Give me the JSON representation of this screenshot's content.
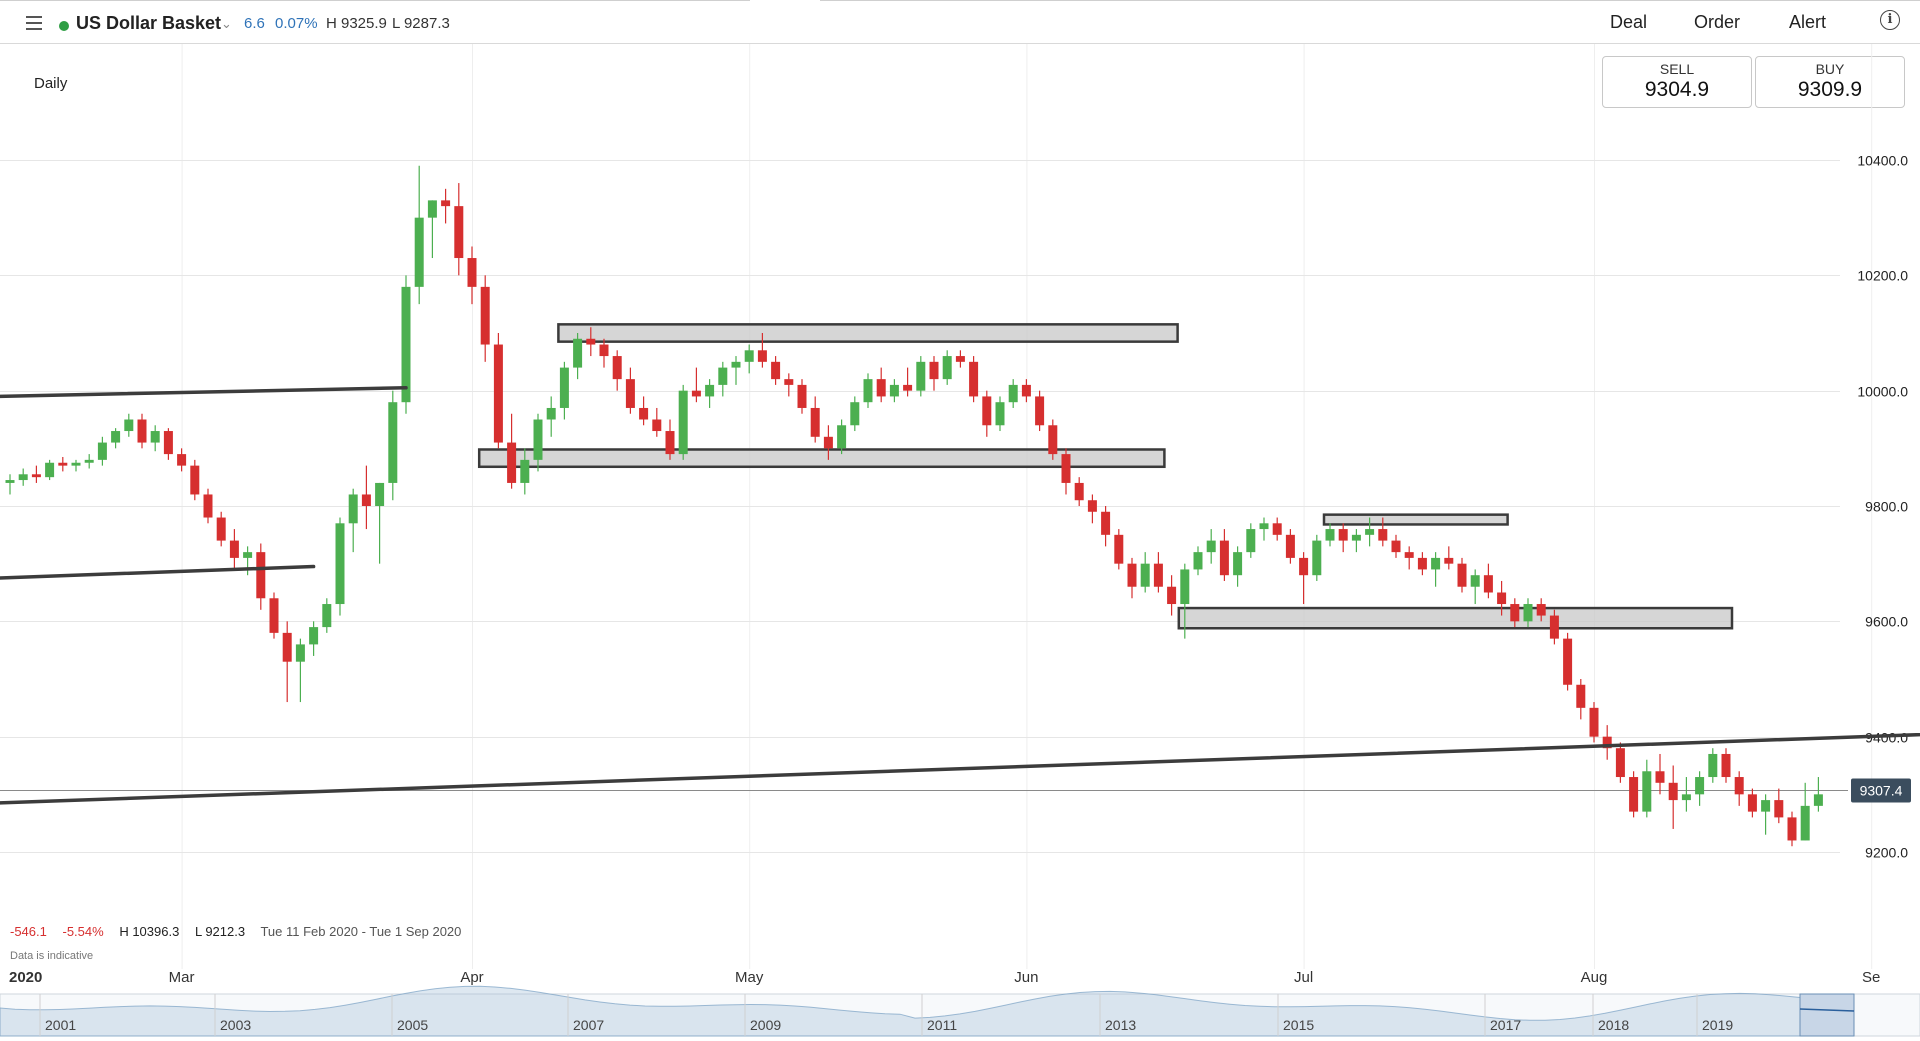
{
  "header": {
    "instrument": "US Dollar Basket",
    "change_points": "6.6",
    "change_pct": "0.07%",
    "high": "H 9325.9",
    "low": "L 9287.3",
    "actions": {
      "deal": "Deal",
      "order": "Order",
      "alert": "Alert"
    },
    "icons": {
      "menu": "hamburger-menu-icon",
      "chevron": "chevron-down-icon",
      "info": "info-icon",
      "status": "market-open-dot"
    }
  },
  "timeframe": "Daily",
  "quote": {
    "sell_label": "SELL",
    "sell_value": "9304.9",
    "buy_label": "BUY",
    "buy_value": "9309.9"
  },
  "stats": {
    "change": "-546.1",
    "change_pct": "-5.54%",
    "high": "H 10396.3",
    "low": "L 9212.3",
    "range": "Tue 11 Feb 2020 - Tue 1 Sep 2020",
    "note": "Data is indicative"
  },
  "colors": {
    "up": "#4caf50",
    "down": "#d62f2f",
    "accent": "#2f73b8",
    "status": "#2e9e44",
    "current_tag": "#3b4d5e"
  },
  "chart_data": {
    "type": "candlestick",
    "timeframe": "Daily",
    "ylim": [
      9000,
      10600
    ],
    "yticks": [
      10400,
      10200,
      10000,
      9800,
      9600,
      9400,
      9200
    ],
    "ytick_labels": [
      "10400.0",
      "10200.0",
      "10000.0",
      "9800.0",
      "9600.0",
      "9400.0",
      "9200.0"
    ],
    "x_labels": [
      {
        "label": "2020",
        "session": 0
      },
      {
        "label": "Mar",
        "session": 13
      },
      {
        "label": "Apr",
        "session": 35
      },
      {
        "label": "May",
        "session": 56
      },
      {
        "label": "Jun",
        "session": 77
      },
      {
        "label": "Jul",
        "session": 98
      },
      {
        "label": "Aug",
        "session": 120
      },
      {
        "label": "Se",
        "session": 141
      }
    ],
    "current_price": 9307.4,
    "current_price_label": "9307.4",
    "ohlc": [
      [
        9840,
        9855,
        9820,
        9845
      ],
      [
        9845,
        9865,
        9835,
        9855
      ],
      [
        9855,
        9870,
        9840,
        9850
      ],
      [
        9850,
        9880,
        9845,
        9875
      ],
      [
        9875,
        9885,
        9860,
        9870
      ],
      [
        9870,
        9880,
        9860,
        9875
      ],
      [
        9875,
        9890,
        9865,
        9880
      ],
      [
        9880,
        9920,
        9870,
        9910
      ],
      [
        9910,
        9935,
        9900,
        9930
      ],
      [
        9930,
        9960,
        9920,
        9950
      ],
      [
        9950,
        9960,
        9900,
        9910
      ],
      [
        9910,
        9940,
        9895,
        9930
      ],
      [
        9930,
        9935,
        9880,
        9890
      ],
      [
        9890,
        9900,
        9860,
        9870
      ],
      [
        9870,
        9880,
        9810,
        9820
      ],
      [
        9820,
        9830,
        9770,
        9780
      ],
      [
        9780,
        9790,
        9730,
        9740
      ],
      [
        9740,
        9760,
        9690,
        9710
      ],
      [
        9710,
        9730,
        9680,
        9720
      ],
      [
        9720,
        9735,
        9620,
        9640
      ],
      [
        9640,
        9650,
        9570,
        9580
      ],
      [
        9580,
        9600,
        9460,
        9530
      ],
      [
        9530,
        9570,
        9460,
        9560
      ],
      [
        9560,
        9600,
        9540,
        9590
      ],
      [
        9590,
        9640,
        9580,
        9630
      ],
      [
        9630,
        9780,
        9610,
        9770
      ],
      [
        9770,
        9830,
        9720,
        9820
      ],
      [
        9820,
        9870,
        9760,
        9800
      ],
      [
        9800,
        9840,
        9700,
        9840
      ],
      [
        9840,
        10000,
        9810,
        9980
      ],
      [
        9980,
        10200,
        9960,
        10180
      ],
      [
        10180,
        10390,
        10150,
        10300
      ],
      [
        10300,
        10330,
        10230,
        10330
      ],
      [
        10330,
        10350,
        10290,
        10320
      ],
      [
        10320,
        10360,
        10200,
        10230
      ],
      [
        10230,
        10250,
        10150,
        10180
      ],
      [
        10180,
        10200,
        10050,
        10080
      ],
      [
        10080,
        10100,
        9900,
        9910
      ],
      [
        9910,
        9960,
        9830,
        9840
      ],
      [
        9840,
        9900,
        9820,
        9880
      ],
      [
        9880,
        9960,
        9860,
        9950
      ],
      [
        9950,
        9990,
        9920,
        9970
      ],
      [
        9970,
        10050,
        9950,
        10040
      ],
      [
        10040,
        10100,
        10020,
        10090
      ],
      [
        10090,
        10110,
        10060,
        10080
      ],
      [
        10080,
        10090,
        10040,
        10060
      ],
      [
        10060,
        10070,
        10000,
        10020
      ],
      [
        10020,
        10040,
        9960,
        9970
      ],
      [
        9970,
        9990,
        9940,
        9950
      ],
      [
        9950,
        9970,
        9920,
        9930
      ],
      [
        9930,
        9950,
        9880,
        9890
      ],
      [
        9890,
        10010,
        9880,
        10000
      ],
      [
        10000,
        10040,
        9980,
        9990
      ],
      [
        9990,
        10020,
        9970,
        10010
      ],
      [
        10010,
        10050,
        9990,
        10040
      ],
      [
        10040,
        10060,
        10010,
        10050
      ],
      [
        10050,
        10080,
        10030,
        10070
      ],
      [
        10070,
        10100,
        10040,
        10050
      ],
      [
        10050,
        10060,
        10010,
        10020
      ],
      [
        10020,
        10030,
        9990,
        10010
      ],
      [
        10010,
        10020,
        9960,
        9970
      ],
      [
        9970,
        9990,
        9910,
        9920
      ],
      [
        9920,
        9940,
        9880,
        9900
      ],
      [
        9900,
        9950,
        9890,
        9940
      ],
      [
        9940,
        9990,
        9930,
        9980
      ],
      [
        9980,
        10030,
        9970,
        10020
      ],
      [
        10020,
        10040,
        9980,
        9990
      ],
      [
        9990,
        10020,
        9980,
        10010
      ],
      [
        10010,
        10040,
        9990,
        10000
      ],
      [
        10000,
        10060,
        9990,
        10050
      ],
      [
        10050,
        10060,
        10000,
        10020
      ],
      [
        10020,
        10070,
        10010,
        10060
      ],
      [
        10060,
        10070,
        10040,
        10050
      ],
      [
        10050,
        10060,
        9980,
        9990
      ],
      [
        9990,
        10000,
        9920,
        9940
      ],
      [
        9940,
        9990,
        9930,
        9980
      ],
      [
        9980,
        10020,
        9970,
        10010
      ],
      [
        10010,
        10020,
        9980,
        9990
      ],
      [
        9990,
        10000,
        9930,
        9940
      ],
      [
        9940,
        9950,
        9880,
        9890
      ],
      [
        9890,
        9900,
        9820,
        9840
      ],
      [
        9840,
        9850,
        9800,
        9810
      ],
      [
        9810,
        9820,
        9770,
        9790
      ],
      [
        9790,
        9800,
        9730,
        9750
      ],
      [
        9750,
        9760,
        9690,
        9700
      ],
      [
        9700,
        9710,
        9640,
        9660
      ],
      [
        9660,
        9720,
        9650,
        9700
      ],
      [
        9700,
        9720,
        9650,
        9660
      ],
      [
        9660,
        9680,
        9610,
        9630
      ],
      [
        9630,
        9700,
        9570,
        9690
      ],
      [
        9690,
        9730,
        9680,
        9720
      ],
      [
        9720,
        9760,
        9700,
        9740
      ],
      [
        9740,
        9760,
        9670,
        9680
      ],
      [
        9680,
        9730,
        9660,
        9720
      ],
      [
        9720,
        9770,
        9710,
        9760
      ],
      [
        9760,
        9780,
        9740,
        9770
      ],
      [
        9770,
        9780,
        9740,
        9750
      ],
      [
        9750,
        9760,
        9700,
        9710
      ],
      [
        9710,
        9720,
        9630,
        9680
      ],
      [
        9680,
        9750,
        9670,
        9740
      ],
      [
        9740,
        9770,
        9730,
        9760
      ],
      [
        9760,
        9770,
        9720,
        9740
      ],
      [
        9740,
        9760,
        9720,
        9750
      ],
      [
        9750,
        9780,
        9730,
        9760
      ],
      [
        9760,
        9780,
        9730,
        9740
      ],
      [
        9740,
        9750,
        9710,
        9720
      ],
      [
        9720,
        9730,
        9690,
        9710
      ],
      [
        9710,
        9720,
        9680,
        9690
      ],
      [
        9690,
        9720,
        9660,
        9710
      ],
      [
        9710,
        9730,
        9690,
        9700
      ],
      [
        9700,
        9710,
        9650,
        9660
      ],
      [
        9660,
        9690,
        9630,
        9680
      ],
      [
        9680,
        9700,
        9640,
        9650
      ],
      [
        9650,
        9670,
        9610,
        9630
      ],
      [
        9630,
        9640,
        9590,
        9600
      ],
      [
        9600,
        9640,
        9590,
        9630
      ],
      [
        9630,
        9640,
        9600,
        9610
      ],
      [
        9610,
        9620,
        9560,
        9570
      ],
      [
        9570,
        9580,
        9480,
        9490
      ],
      [
        9490,
        9500,
        9430,
        9450
      ],
      [
        9450,
        9460,
        9390,
        9400
      ],
      [
        9400,
        9420,
        9360,
        9380
      ],
      [
        9380,
        9390,
        9320,
        9330
      ],
      [
        9330,
        9340,
        9260,
        9270
      ],
      [
        9270,
        9360,
        9260,
        9340
      ],
      [
        9340,
        9370,
        9300,
        9320
      ],
      [
        9320,
        9350,
        9240,
        9290
      ],
      [
        9290,
        9330,
        9270,
        9300
      ],
      [
        9300,
        9340,
        9280,
        9330
      ],
      [
        9330,
        9380,
        9320,
        9370
      ],
      [
        9370,
        9380,
        9320,
        9330
      ],
      [
        9330,
        9340,
        9280,
        9300
      ],
      [
        9300,
        9310,
        9260,
        9270
      ],
      [
        9270,
        9300,
        9230,
        9290
      ],
      [
        9290,
        9310,
        9250,
        9260
      ],
      [
        9260,
        9270,
        9210,
        9220
      ],
      [
        9220,
        9320,
        9220,
        9280
      ],
      [
        9280,
        9330,
        9270,
        9300
      ]
    ],
    "trendlines": [
      {
        "from": {
          "session": -1,
          "price": 9990
        },
        "to": {
          "session": 30,
          "price": 10005
        }
      },
      {
        "from": {
          "session": -1,
          "price": 9675
        },
        "to": {
          "session": 23,
          "price": 9695
        }
      },
      {
        "from": {
          "session": -1,
          "price": 9285
        },
        "to": {
          "session": 165,
          "price": 9420
        }
      }
    ],
    "zones": [
      {
        "from_session": 42,
        "to_session": 88,
        "top": 10115,
        "bottom": 10085
      },
      {
        "from_session": 36,
        "to_session": 87,
        "top": 9898,
        "bottom": 9868
      },
      {
        "from_session": 100,
        "to_session": 113,
        "top": 9785,
        "bottom": 9768
      },
      {
        "from_session": 89,
        "to_session": 130,
        "top": 9623,
        "bottom": 9588
      }
    ]
  },
  "navigator": {
    "years": [
      "2001",
      "2003",
      "2005",
      "2007",
      "2009",
      "2011",
      "2013",
      "2015",
      "2017",
      "2018",
      "2019"
    ]
  }
}
